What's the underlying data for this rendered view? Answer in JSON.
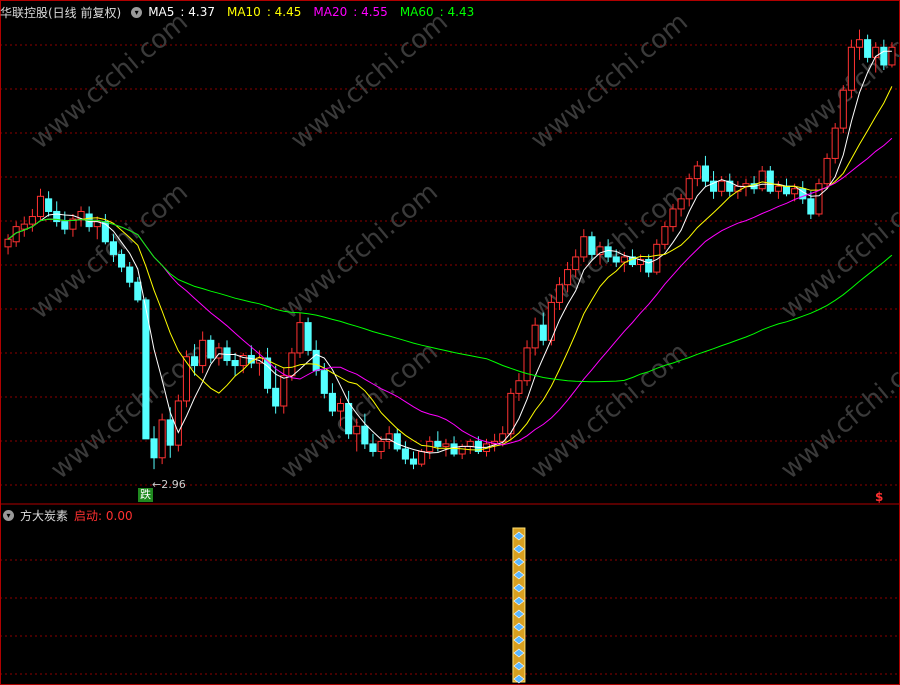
{
  "header": {
    "title": "华联控股(日线 前复权)",
    "ma": [
      {
        "label": "MA5",
        "value": "4.37",
        "color": "#ffffff"
      },
      {
        "label": "MA10",
        "value": "4.45",
        "color": "#ffff00"
      },
      {
        "label": "MA20",
        "value": "4.55",
        "color": "#ff00ff"
      },
      {
        "label": "MA60",
        "value": "4.43",
        "color": "#00ff00"
      }
    ]
  },
  "annotations": {
    "low_label": "←2.96",
    "signal_tag": "跌",
    "dollar_mark": "$"
  },
  "indicator": {
    "name": "方大炭素",
    "param_label": "启动: 0.00"
  },
  "watermark": "www.cfchi.com",
  "chart_data": [
    {
      "type": "candlestick",
      "title": "华联控股(日线 前复权)",
      "ylim": [
        2.7,
        6.5
      ],
      "low_marker": 2.96,
      "ohlc": [
        [
          4.72,
          4.82,
          4.66,
          4.78
        ],
        [
          4.76,
          4.92,
          4.72,
          4.88
        ],
        [
          4.86,
          4.96,
          4.8,
          4.9
        ],
        [
          4.9,
          5.02,
          4.84,
          4.96
        ],
        [
          4.96,
          5.18,
          4.92,
          5.12
        ],
        [
          5.1,
          5.16,
          4.96,
          5.0
        ],
        [
          5.0,
          5.08,
          4.88,
          4.92
        ],
        [
          4.92,
          5.0,
          4.82,
          4.86
        ],
        [
          4.86,
          4.98,
          4.8,
          4.94
        ],
        [
          4.94,
          5.04,
          4.88,
          5.0
        ],
        [
          4.98,
          5.04,
          4.84,
          4.88
        ],
        [
          4.88,
          4.96,
          4.78,
          4.92
        ],
        [
          4.92,
          4.98,
          4.74,
          4.76
        ],
        [
          4.76,
          4.82,
          4.6,
          4.66
        ],
        [
          4.66,
          4.7,
          4.52,
          4.56
        ],
        [
          4.56,
          4.6,
          4.4,
          4.44
        ],
        [
          4.44,
          4.48,
          4.28,
          4.3
        ],
        [
          4.3,
          4.32,
          3.5,
          3.2
        ],
        [
          3.2,
          3.3,
          2.96,
          3.05
        ],
        [
          3.05,
          3.4,
          3.0,
          3.35
        ],
        [
          3.35,
          3.45,
          3.05,
          3.15
        ],
        [
          3.15,
          3.55,
          3.1,
          3.5
        ],
        [
          3.5,
          3.9,
          3.45,
          3.85
        ],
        [
          3.85,
          3.95,
          3.7,
          3.78
        ],
        [
          3.78,
          4.05,
          3.72,
          3.98
        ],
        [
          3.98,
          4.02,
          3.8,
          3.84
        ],
        [
          3.84,
          3.96,
          3.78,
          3.92
        ],
        [
          3.92,
          3.98,
          3.78,
          3.82
        ],
        [
          3.82,
          3.88,
          3.7,
          3.78
        ],
        [
          3.78,
          3.88,
          3.72,
          3.86
        ],
        [
          3.86,
          3.94,
          3.76,
          3.8
        ],
        [
          3.8,
          3.9,
          3.7,
          3.84
        ],
        [
          3.84,
          3.92,
          3.56,
          3.6
        ],
        [
          3.6,
          3.78,
          3.4,
          3.46
        ],
        [
          3.46,
          3.76,
          3.4,
          3.7
        ],
        [
          3.7,
          3.92,
          3.66,
          3.88
        ],
        [
          3.88,
          4.2,
          3.84,
          4.12
        ],
        [
          4.12,
          4.16,
          3.86,
          3.9
        ],
        [
          3.9,
          3.98,
          3.7,
          3.74
        ],
        [
          3.74,
          3.8,
          3.52,
          3.56
        ],
        [
          3.56,
          3.64,
          3.38,
          3.42
        ],
        [
          3.42,
          3.52,
          3.3,
          3.48
        ],
        [
          3.48,
          3.58,
          3.2,
          3.24
        ],
        [
          3.24,
          3.36,
          3.1,
          3.3
        ],
        [
          3.3,
          3.4,
          3.12,
          3.16
        ],
        [
          3.16,
          3.24,
          3.06,
          3.1
        ],
        [
          3.1,
          3.22,
          3.04,
          3.18
        ],
        [
          3.18,
          3.3,
          3.12,
          3.24
        ],
        [
          3.24,
          3.28,
          3.1,
          3.12
        ],
        [
          3.12,
          3.18,
          3.0,
          3.04
        ],
        [
          3.04,
          3.1,
          2.96,
          3.0
        ],
        [
          3.0,
          3.12,
          2.98,
          3.1
        ],
        [
          3.1,
          3.22,
          3.04,
          3.18
        ],
        [
          3.18,
          3.26,
          3.1,
          3.14
        ],
        [
          3.14,
          3.2,
          3.06,
          3.16
        ],
        [
          3.16,
          3.22,
          3.06,
          3.08
        ],
        [
          3.08,
          3.16,
          3.04,
          3.14
        ],
        [
          3.14,
          3.2,
          3.08,
          3.18
        ],
        [
          3.18,
          3.22,
          3.08,
          3.1
        ],
        [
          3.1,
          3.2,
          3.06,
          3.16
        ],
        [
          3.16,
          3.24,
          3.1,
          3.18
        ],
        [
          3.18,
          3.3,
          3.14,
          3.24
        ],
        [
          3.24,
          3.6,
          3.2,
          3.56
        ],
        [
          3.56,
          3.72,
          3.5,
          3.66
        ],
        [
          3.66,
          3.98,
          3.62,
          3.92
        ],
        [
          3.92,
          4.16,
          3.86,
          4.1
        ],
        [
          4.1,
          4.2,
          3.94,
          3.98
        ],
        [
          3.98,
          4.34,
          3.94,
          4.28
        ],
        [
          4.28,
          4.48,
          4.22,
          4.42
        ],
        [
          4.42,
          4.6,
          4.36,
          4.54
        ],
        [
          4.54,
          4.7,
          4.48,
          4.64
        ],
        [
          4.64,
          4.86,
          4.6,
          4.8
        ],
        [
          4.8,
          4.84,
          4.62,
          4.66
        ],
        [
          4.66,
          4.76,
          4.58,
          4.72
        ],
        [
          4.72,
          4.78,
          4.6,
          4.64
        ],
        [
          4.64,
          4.7,
          4.56,
          4.6
        ],
        [
          4.6,
          4.68,
          4.52,
          4.64
        ],
        [
          4.64,
          4.7,
          4.56,
          4.58
        ],
        [
          4.58,
          4.66,
          4.52,
          4.62
        ],
        [
          4.62,
          4.66,
          4.48,
          4.52
        ],
        [
          4.52,
          4.78,
          4.5,
          4.74
        ],
        [
          4.74,
          4.92,
          4.7,
          4.88
        ],
        [
          4.88,
          5.06,
          4.84,
          5.02
        ],
        [
          5.02,
          5.14,
          4.96,
          5.1
        ],
        [
          5.1,
          5.3,
          5.04,
          5.26
        ],
        [
          5.26,
          5.4,
          5.2,
          5.36
        ],
        [
          5.36,
          5.44,
          5.2,
          5.24
        ],
        [
          5.24,
          5.32,
          5.1,
          5.16
        ],
        [
          5.16,
          5.28,
          5.12,
          5.24
        ],
        [
          5.24,
          5.3,
          5.12,
          5.16
        ],
        [
          5.16,
          5.24,
          5.1,
          5.2
        ],
        [
          5.2,
          5.26,
          5.12,
          5.22
        ],
        [
          5.22,
          5.28,
          5.14,
          5.18
        ],
        [
          5.18,
          5.36,
          5.16,
          5.32
        ],
        [
          5.32,
          5.36,
          5.14,
          5.16
        ],
        [
          5.16,
          5.24,
          5.1,
          5.2
        ],
        [
          5.2,
          5.26,
          5.12,
          5.14
        ],
        [
          5.14,
          5.22,
          5.08,
          5.18
        ],
        [
          5.18,
          5.24,
          5.06,
          5.1
        ],
        [
          5.1,
          5.16,
          4.94,
          4.98
        ],
        [
          4.98,
          5.26,
          4.96,
          5.22
        ],
        [
          5.22,
          5.46,
          5.18,
          5.42
        ],
        [
          5.42,
          5.7,
          5.38,
          5.66
        ],
        [
          5.66,
          6.0,
          5.62,
          5.96
        ],
        [
          5.96,
          6.36,
          5.9,
          6.3
        ],
        [
          6.3,
          6.44,
          6.2,
          6.36
        ],
        [
          6.36,
          6.4,
          6.18,
          6.22
        ],
        [
          6.22,
          6.34,
          6.1,
          6.3
        ],
        [
          6.3,
          6.36,
          6.12,
          6.16
        ],
        [
          6.16,
          6.34,
          6.14,
          6.3
        ]
      ],
      "series": [
        {
          "name": "MA5",
          "color": "#ffffff"
        },
        {
          "name": "MA10",
          "color": "#ffff00"
        },
        {
          "name": "MA20",
          "color": "#ff00ff"
        },
        {
          "name": "MA60",
          "color": "#00ff00"
        }
      ]
    },
    {
      "type": "bar",
      "title": "方大炭素",
      "signal_bar_index": 63,
      "signal_value": 1.0
    }
  ]
}
